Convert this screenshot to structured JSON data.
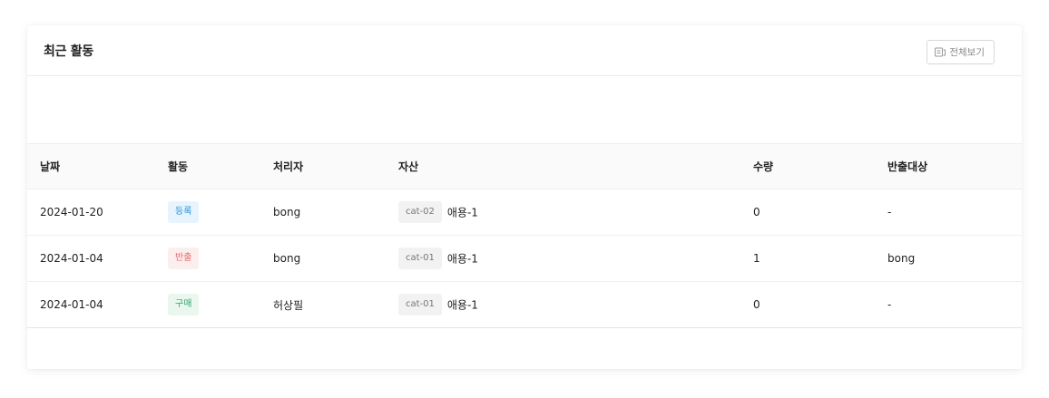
{
  "header": {
    "title": "최근 활동",
    "view_all_label": "전체보기",
    "view_all_icon": "list-icon"
  },
  "table": {
    "columns": [
      "날짜",
      "활동",
      "처리자",
      "자산",
      "수량",
      "반출대상"
    ],
    "rows": [
      {
        "date": "2024-01-20",
        "activity": "등록",
        "activity_color": "blue",
        "handler": "bong",
        "asset_code": "cat-02",
        "asset_name": "애용-1",
        "quantity": "0",
        "target": "-"
      },
      {
        "date": "2024-01-04",
        "activity": "반출",
        "activity_color": "red",
        "handler": "bong",
        "asset_code": "cat-01",
        "asset_name": "애용-1",
        "quantity": "1",
        "target": "bong"
      },
      {
        "date": "2024-01-04",
        "activity": "구매",
        "activity_color": "green",
        "handler": "허상필",
        "asset_code": "cat-01",
        "asset_name": "애용-1",
        "quantity": "0",
        "target": "-"
      }
    ]
  },
  "colors": {
    "tag_blue": "#2b8fd6",
    "tag_red": "#e46a6a",
    "tag_green": "#36a66b"
  }
}
